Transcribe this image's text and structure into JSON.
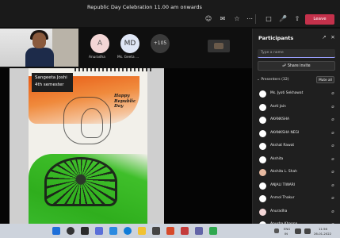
{
  "meeting": {
    "title": "Republic Day Celebration 11.00 am onwards",
    "timer": "",
    "leave_label": "Leave"
  },
  "tiles": [
    {
      "initials": "A",
      "name": "Anuradha",
      "bg": "#f3d6d6"
    },
    {
      "initials": "MD",
      "name": "Ms. Geeta ...",
      "bg": "#dfe6f5"
    },
    {
      "initials": "+105",
      "name": "",
      "bg": "#3a3a3a"
    }
  ],
  "shared_content": {
    "label_line1": "Sangeeta Joshi",
    "label_line2": "4th semester",
    "drawing_text": "Happy Republic Day"
  },
  "panel": {
    "title": "Participants",
    "search_placeholder": "Type a name",
    "share_invite": "Share invite",
    "section": "Presenters (32)",
    "mute_all": "Mute all",
    "participants": [
      {
        "name": "Ms. Jyoti Sekhawat",
        "color": "#ffffff"
      },
      {
        "name": "Aarti Jain",
        "color": "#ffffff"
      },
      {
        "name": "AKANKSHA",
        "color": "#ffffff"
      },
      {
        "name": "AKANKSHA NEGI",
        "color": "#ffffff"
      },
      {
        "name": "Akshat Rawat",
        "color": "#ffffff"
      },
      {
        "name": "Akshita",
        "color": "#ffffff"
      },
      {
        "name": "Akshita L. Shah",
        "color": "#e7b9a0"
      },
      {
        "name": "ANJALI TIWARI",
        "color": "#ffffff"
      },
      {
        "name": "Anmol Thakur",
        "color": "#ffffff"
      },
      {
        "name": "Anuradha",
        "color": "#f3d6d6"
      },
      {
        "name": "Anusha Khanna",
        "color": "#ffffff"
      }
    ]
  },
  "taskbar": {
    "lang_top": "ENG",
    "lang_bottom": "IN",
    "time": "11:56",
    "date": "26-01-2022"
  },
  "colors": {
    "leave": "#c4314b",
    "accent": "#9aa0ff",
    "taskbar": "#cdd3dc"
  }
}
